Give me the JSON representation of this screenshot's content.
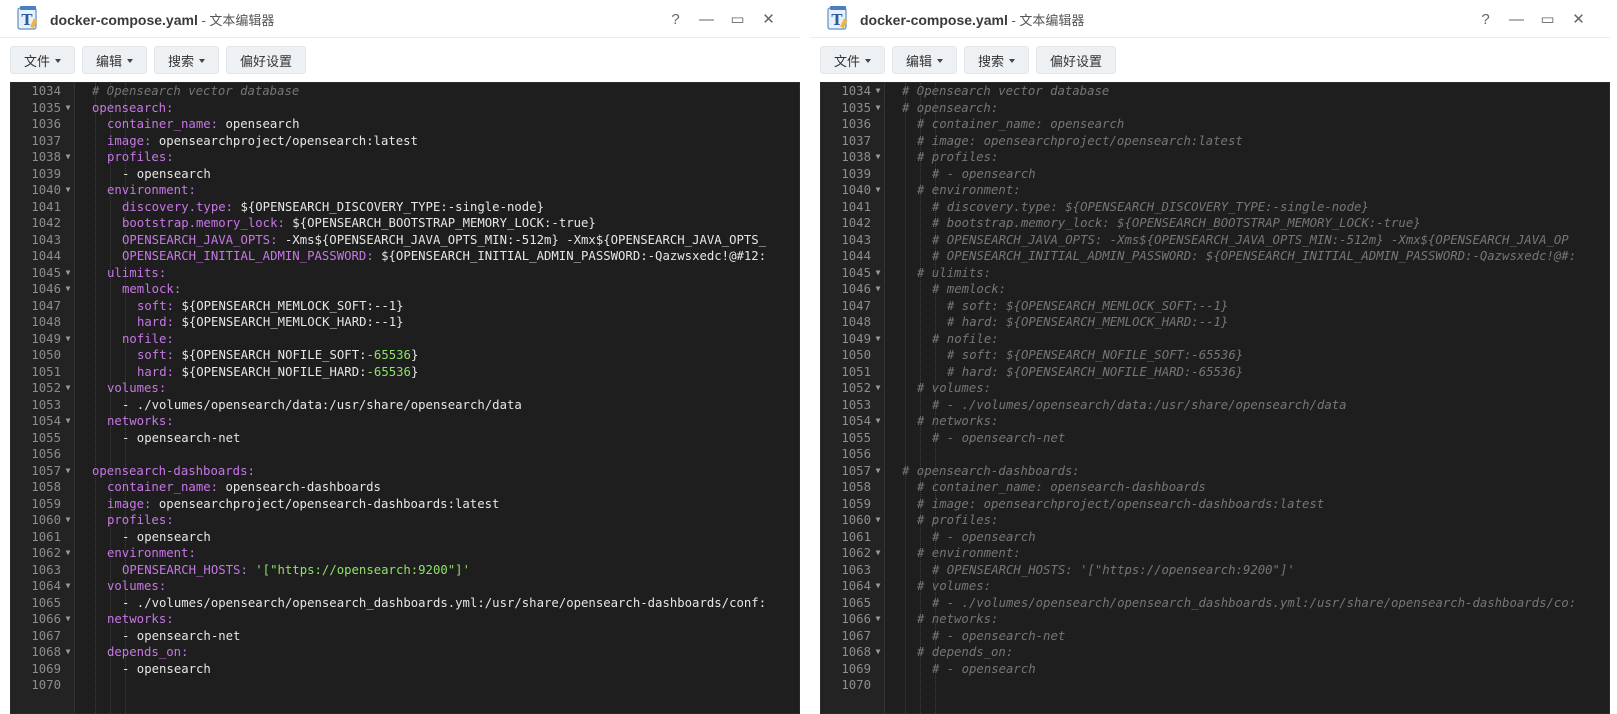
{
  "windows": [
    {
      "title": "docker-compose.yaml",
      "subtitle": " - 文本编辑器",
      "controls": [
        "?",
        "—",
        "▭",
        "✕"
      ],
      "menu": [
        {
          "label": "文件",
          "dropdown": true
        },
        {
          "label": "编辑",
          "dropdown": true
        },
        {
          "label": "搜索",
          "dropdown": true
        },
        {
          "label": "偏好设置",
          "dropdown": false
        }
      ],
      "lines": [
        {
          "num": "1034",
          "fold": false,
          "indent": 0,
          "text": "# Opensearch vector database",
          "kind": "comment"
        },
        {
          "num": "1035",
          "fold": true,
          "indent": 0,
          "key": "opensearch",
          "val": "",
          "kind": "kv"
        },
        {
          "num": "1036",
          "fold": false,
          "indent": 1,
          "key": "container_name",
          "val": "opensearch",
          "kind": "kv"
        },
        {
          "num": "1037",
          "fold": false,
          "indent": 1,
          "key": "image",
          "val": "opensearchproject/opensearch:latest",
          "kind": "kv"
        },
        {
          "num": "1038",
          "fold": true,
          "indent": 1,
          "key": "profiles",
          "val": "",
          "kind": "kv"
        },
        {
          "num": "1039",
          "fold": false,
          "indent": 2,
          "text": "- opensearch",
          "kind": "plain"
        },
        {
          "num": "1040",
          "fold": true,
          "indent": 1,
          "key": "environment",
          "val": "",
          "kind": "kv"
        },
        {
          "num": "1041",
          "fold": false,
          "indent": 2,
          "key": "discovery.type",
          "val": "${OPENSEARCH_DISCOVERY_TYPE:-single-node}",
          "kind": "kv"
        },
        {
          "num": "1042",
          "fold": false,
          "indent": 2,
          "key": "bootstrap.memory_lock",
          "val": "${OPENSEARCH_BOOTSTRAP_MEMORY_LOCK:-true}",
          "kind": "kv"
        },
        {
          "num": "1043",
          "fold": false,
          "indent": 2,
          "key": "OPENSEARCH_JAVA_OPTS",
          "val": "-Xms${OPENSEARCH_JAVA_OPTS_MIN:-512m} -Xmx${OPENSEARCH_JAVA_OPTS_",
          "kind": "kv"
        },
        {
          "num": "1044",
          "fold": false,
          "indent": 2,
          "key": "OPENSEARCH_INITIAL_ADMIN_PASSWORD",
          "val": "${OPENSEARCH_INITIAL_ADMIN_PASSWORD:-Qazwsxedc!@#12:",
          "kind": "kv"
        },
        {
          "num": "1045",
          "fold": true,
          "indent": 1,
          "key": "ulimits",
          "val": "",
          "kind": "kv"
        },
        {
          "num": "1046",
          "fold": true,
          "indent": 2,
          "key": "memlock",
          "val": "",
          "kind": "kv"
        },
        {
          "num": "1047",
          "fold": false,
          "indent": 3,
          "key": "soft",
          "val": "${OPENSEARCH_MEMLOCK_SOFT:--1}",
          "kind": "kv"
        },
        {
          "num": "1048",
          "fold": false,
          "indent": 3,
          "key": "hard",
          "val": "${OPENSEARCH_MEMLOCK_HARD:--1}",
          "kind": "kv"
        },
        {
          "num": "1049",
          "fold": true,
          "indent": 2,
          "key": "nofile",
          "val": "",
          "kind": "kv"
        },
        {
          "num": "1050",
          "fold": false,
          "indent": 3,
          "key": "soft",
          "val": "${OPENSEARCH_NOFILE_SOFT:",
          "num_val": "-65536",
          "tail": "}",
          "kind": "kvnum"
        },
        {
          "num": "1051",
          "fold": false,
          "indent": 3,
          "key": "hard",
          "val": "${OPENSEARCH_NOFILE_HARD:",
          "num_val": "-65536",
          "tail": "}",
          "kind": "kvnum"
        },
        {
          "num": "1052",
          "fold": true,
          "indent": 1,
          "key": "volumes",
          "val": "",
          "kind": "kv"
        },
        {
          "num": "1053",
          "fold": false,
          "indent": 2,
          "text": "- ./volumes/opensearch/data:/usr/share/opensearch/data",
          "kind": "plain"
        },
        {
          "num": "1054",
          "fold": true,
          "indent": 1,
          "key": "networks",
          "val": "",
          "kind": "kv"
        },
        {
          "num": "1055",
          "fold": false,
          "indent": 2,
          "text": "- opensearch-net",
          "kind": "plain"
        },
        {
          "num": "1056",
          "fold": false,
          "indent": 0,
          "text": "",
          "kind": "plain"
        },
        {
          "num": "1057",
          "fold": true,
          "indent": 0,
          "key": "opensearch-dashboards",
          "val": "",
          "kind": "kv"
        },
        {
          "num": "1058",
          "fold": false,
          "indent": 1,
          "key": "container_name",
          "val": "opensearch-dashboards",
          "kind": "kv"
        },
        {
          "num": "1059",
          "fold": false,
          "indent": 1,
          "key": "image",
          "val": "opensearchproject/opensearch-dashboards:latest",
          "kind": "kv"
        },
        {
          "num": "1060",
          "fold": true,
          "indent": 1,
          "key": "profiles",
          "val": "",
          "kind": "kv"
        },
        {
          "num": "1061",
          "fold": false,
          "indent": 2,
          "text": "- opensearch",
          "kind": "plain"
        },
        {
          "num": "1062",
          "fold": true,
          "indent": 1,
          "key": "environment",
          "val": "",
          "kind": "kv"
        },
        {
          "num": "1063",
          "fold": false,
          "indent": 2,
          "key": "OPENSEARCH_HOSTS",
          "val": "",
          "str_val": "'[\"https://opensearch:9200\"]'",
          "kind": "kvstr"
        },
        {
          "num": "1064",
          "fold": true,
          "indent": 1,
          "key": "volumes",
          "val": "",
          "kind": "kv"
        },
        {
          "num": "1065",
          "fold": false,
          "indent": 2,
          "text": "- ./volumes/opensearch/opensearch_dashboards.yml:/usr/share/opensearch-dashboards/conf:",
          "kind": "plain"
        },
        {
          "num": "1066",
          "fold": true,
          "indent": 1,
          "key": "networks",
          "val": "",
          "kind": "kv"
        },
        {
          "num": "1067",
          "fold": false,
          "indent": 2,
          "text": "- opensearch-net",
          "kind": "plain"
        },
        {
          "num": "1068",
          "fold": true,
          "indent": 1,
          "key": "depends_on",
          "val": "",
          "kind": "kv"
        },
        {
          "num": "1069",
          "fold": false,
          "indent": 2,
          "text": "- opensearch",
          "kind": "plain"
        },
        {
          "num": "1070",
          "fold": false,
          "indent": 0,
          "text": "",
          "kind": "plain"
        }
      ]
    },
    {
      "title": "docker-compose.yaml",
      "subtitle": " - 文本编辑器",
      "controls": [
        "?",
        "—",
        "▭",
        "✕"
      ],
      "menu": [
        {
          "label": "文件",
          "dropdown": true
        },
        {
          "label": "编辑",
          "dropdown": true
        },
        {
          "label": "搜索",
          "dropdown": true
        },
        {
          "label": "偏好设置",
          "dropdown": false
        }
      ],
      "lines": [
        {
          "num": "1034",
          "fold": true,
          "indent": 0,
          "text": "# Opensearch vector database",
          "kind": "comment"
        },
        {
          "num": "1035",
          "fold": true,
          "indent": 0,
          "text": "# opensearch:",
          "kind": "comment"
        },
        {
          "num": "1036",
          "fold": false,
          "indent": 1,
          "text": "# container_name: opensearch",
          "kind": "comment"
        },
        {
          "num": "1037",
          "fold": false,
          "indent": 1,
          "text": "# image: opensearchproject/opensearch:latest",
          "kind": "comment"
        },
        {
          "num": "1038",
          "fold": true,
          "indent": 1,
          "text": "# profiles:",
          "kind": "comment"
        },
        {
          "num": "1039",
          "fold": false,
          "indent": 2,
          "text": "# - opensearch",
          "kind": "comment"
        },
        {
          "num": "1040",
          "fold": true,
          "indent": 1,
          "text": "# environment:",
          "kind": "comment"
        },
        {
          "num": "1041",
          "fold": false,
          "indent": 2,
          "text": "# discovery.type: ${OPENSEARCH_DISCOVERY_TYPE:-single-node}",
          "kind": "comment"
        },
        {
          "num": "1042",
          "fold": false,
          "indent": 2,
          "text": "# bootstrap.memory_lock: ${OPENSEARCH_BOOTSTRAP_MEMORY_LOCK:-true}",
          "kind": "comment"
        },
        {
          "num": "1043",
          "fold": false,
          "indent": 2,
          "text": "# OPENSEARCH_JAVA_OPTS: -Xms${OPENSEARCH_JAVA_OPTS_MIN:-512m} -Xmx${OPENSEARCH_JAVA_OP",
          "kind": "comment"
        },
        {
          "num": "1044",
          "fold": false,
          "indent": 2,
          "text": "# OPENSEARCH_INITIAL_ADMIN_PASSWORD: ${OPENSEARCH_INITIAL_ADMIN_PASSWORD:-Qazwsxedc!@#:",
          "kind": "comment"
        },
        {
          "num": "1045",
          "fold": true,
          "indent": 1,
          "text": "# ulimits:",
          "kind": "comment"
        },
        {
          "num": "1046",
          "fold": true,
          "indent": 2,
          "text": "# memlock:",
          "kind": "comment"
        },
        {
          "num": "1047",
          "fold": false,
          "indent": 3,
          "text": "# soft: ${OPENSEARCH_MEMLOCK_SOFT:--1}",
          "kind": "comment"
        },
        {
          "num": "1048",
          "fold": false,
          "indent": 3,
          "text": "# hard: ${OPENSEARCH_MEMLOCK_HARD:--1}",
          "kind": "comment"
        },
        {
          "num": "1049",
          "fold": true,
          "indent": 2,
          "text": "# nofile:",
          "kind": "comment"
        },
        {
          "num": "1050",
          "fold": false,
          "indent": 3,
          "text": "# soft: ${OPENSEARCH_NOFILE_SOFT:-65536}",
          "kind": "comment"
        },
        {
          "num": "1051",
          "fold": false,
          "indent": 3,
          "text": "# hard: ${OPENSEARCH_NOFILE_HARD:-65536}",
          "kind": "comment"
        },
        {
          "num": "1052",
          "fold": true,
          "indent": 1,
          "text": "# volumes:",
          "kind": "comment"
        },
        {
          "num": "1053",
          "fold": false,
          "indent": 2,
          "text": "# - ./volumes/opensearch/data:/usr/share/opensearch/data",
          "kind": "comment"
        },
        {
          "num": "1054",
          "fold": true,
          "indent": 1,
          "text": "# networks:",
          "kind": "comment"
        },
        {
          "num": "1055",
          "fold": false,
          "indent": 2,
          "text": "# - opensearch-net",
          "kind": "comment"
        },
        {
          "num": "1056",
          "fold": false,
          "indent": 0,
          "text": "",
          "kind": "plain"
        },
        {
          "num": "1057",
          "fold": true,
          "indent": 0,
          "text": "# opensearch-dashboards:",
          "kind": "comment"
        },
        {
          "num": "1058",
          "fold": false,
          "indent": 1,
          "text": "# container_name: opensearch-dashboards",
          "kind": "comment"
        },
        {
          "num": "1059",
          "fold": false,
          "indent": 1,
          "text": "# image: opensearchproject/opensearch-dashboards:latest",
          "kind": "comment"
        },
        {
          "num": "1060",
          "fold": true,
          "indent": 1,
          "text": "# profiles:",
          "kind": "comment"
        },
        {
          "num": "1061",
          "fold": false,
          "indent": 2,
          "text": "# - opensearch",
          "kind": "comment"
        },
        {
          "num": "1062",
          "fold": true,
          "indent": 1,
          "text": "# environment:",
          "kind": "comment"
        },
        {
          "num": "1063",
          "fold": false,
          "indent": 2,
          "text": "# OPENSEARCH_HOSTS: '[\"https://opensearch:9200\"]'",
          "kind": "comment"
        },
        {
          "num": "1064",
          "fold": true,
          "indent": 1,
          "text": "# volumes:",
          "kind": "comment"
        },
        {
          "num": "1065",
          "fold": false,
          "indent": 2,
          "text": "# - ./volumes/opensearch/opensearch_dashboards.yml:/usr/share/opensearch-dashboards/co:",
          "kind": "comment"
        },
        {
          "num": "1066",
          "fold": true,
          "indent": 1,
          "text": "# networks:",
          "kind": "comment"
        },
        {
          "num": "1067",
          "fold": false,
          "indent": 2,
          "text": "# - opensearch-net",
          "kind": "comment"
        },
        {
          "num": "1068",
          "fold": true,
          "indent": 1,
          "text": "# depends_on:",
          "kind": "comment"
        },
        {
          "num": "1069",
          "fold": false,
          "indent": 2,
          "text": "# - opensearch",
          "kind": "comment"
        },
        {
          "num": "1070",
          "fold": false,
          "indent": 0,
          "text": "",
          "kind": "plain"
        }
      ]
    }
  ]
}
